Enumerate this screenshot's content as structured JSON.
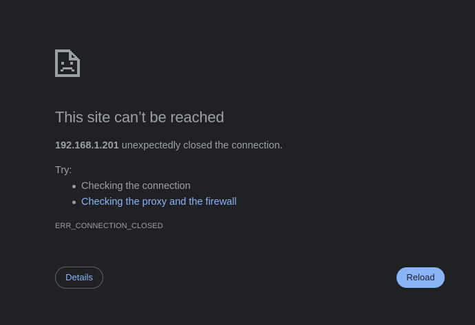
{
  "error": {
    "icon": "sad-document-icon",
    "title": "This site can’t be reached",
    "host": "192.168.1.201",
    "message": " unexpectedly closed the connection.",
    "try_label": "Try:",
    "suggestions": [
      {
        "text": "Checking the connection",
        "is_link": false
      },
      {
        "text": "Checking the proxy and the firewall",
        "is_link": true
      }
    ],
    "code": "ERR_CONNECTION_CLOSED"
  },
  "buttons": {
    "details_label": "Details",
    "reload_label": "Reload"
  },
  "colors": {
    "background": "#202124",
    "text": "#9aa0a6",
    "link": "#8ab4f8",
    "primary_button": "#8ab4f8",
    "outline": "#5f6368"
  }
}
